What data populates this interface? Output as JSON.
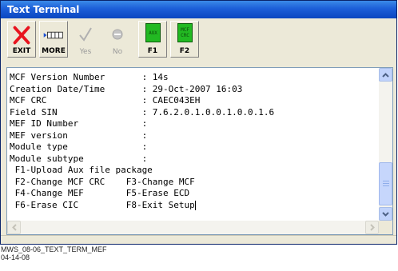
{
  "window": {
    "title": "Text Terminal"
  },
  "toolbar": {
    "exit_label": "EXIT",
    "more_label": "MORE",
    "yes_label": "Yes",
    "no_label": "No",
    "f1_label": "F1",
    "f1_icon_text": "AUX",
    "f2_label": "F2",
    "f2_icon_line1": "MCF",
    "f2_icon_line2": "CRC"
  },
  "terminal": {
    "lines": [
      "MCF Version Number       : 14s",
      "Creation Date/Time       : 29-Oct-2007 16:03",
      "MCF CRC                  : CAEC043EH",
      "Field SIN                : 7.6.2.0.1.0.0.1.0.0.1.6",
      "MEF ID Number            :",
      "MEF version              :",
      "Module type              :",
      "Module subtype           :",
      " F1-Upload Aux file package",
      " F2-Change MCF CRC    F3-Change MCF",
      " F4-Change MEF        F5-Erase ECD",
      " F6-Erase CIC         F8-Exit Setup"
    ]
  },
  "caption": {
    "line1": "MWS_08-06_TEXT_TERM_MEF",
    "line2": "04-14-08"
  },
  "colors": {
    "title_bar": "#0a46c0",
    "exit_red": "#e8141e",
    "fkey_green": "#22b922",
    "scrollbar_blue": "#c1d3fb"
  },
  "icons": {
    "exit": "red-x-icon",
    "more": "more-keys-icon",
    "yes": "checkmark-icon",
    "no": "minus-circle-icon",
    "f1": "aux-chip-icon",
    "f2": "mcf-crc-chip-icon"
  }
}
